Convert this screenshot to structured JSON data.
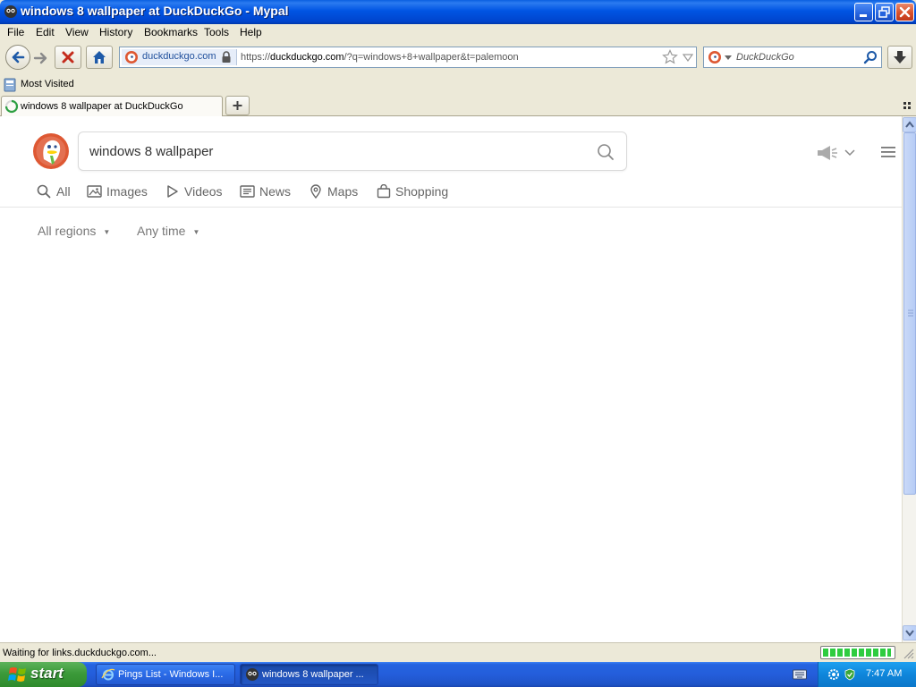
{
  "window": {
    "title": "windows 8 wallpaper at DuckDuckGo - Mypal"
  },
  "menu": {
    "items": [
      {
        "label": "File"
      },
      {
        "label": "Edit"
      },
      {
        "label": "View"
      },
      {
        "label": "History"
      },
      {
        "label": "Bookmarks"
      },
      {
        "label": "Tools"
      },
      {
        "label": "Help"
      }
    ]
  },
  "navbar": {
    "identity_label": "duckduckgo.com",
    "url_prefix": "https://",
    "url_domain": "duckduckgo.com",
    "url_rest": "/?q=windows+8+wallpaper&t=palemoon",
    "search_placeholder": "DuckDuckGo"
  },
  "bookmarks": {
    "most_visited": "Most Visited"
  },
  "tabs": [
    {
      "label": "windows 8 wallpaper at DuckDuckGo",
      "active": true
    }
  ],
  "page": {
    "query": "windows 8 wallpaper",
    "search_tabs": [
      {
        "label": "All",
        "icon": "search-icon"
      },
      {
        "label": "Images",
        "icon": "image-icon"
      },
      {
        "label": "Videos",
        "icon": "play-icon"
      },
      {
        "label": "News",
        "icon": "news-icon"
      },
      {
        "label": "Maps",
        "icon": "map-pin-icon"
      },
      {
        "label": "Shopping",
        "icon": "shopping-bag-icon"
      }
    ],
    "filters": [
      {
        "label": "All regions"
      },
      {
        "label": "Any time"
      }
    ]
  },
  "status": {
    "message": "Waiting for links.duckduckgo.com...",
    "progress_fraction": 0.95
  },
  "taskbar": {
    "start_label": "start",
    "buttons": [
      {
        "label": "Pings List - Windows I..."
      },
      {
        "label": "windows 8 wallpaper ..."
      }
    ],
    "clock": "7:47 AM"
  },
  "colors": {
    "titlebar_blue": "#0054e3",
    "ddg_orange": "#de5833",
    "start_green": "#3c9a3a"
  }
}
